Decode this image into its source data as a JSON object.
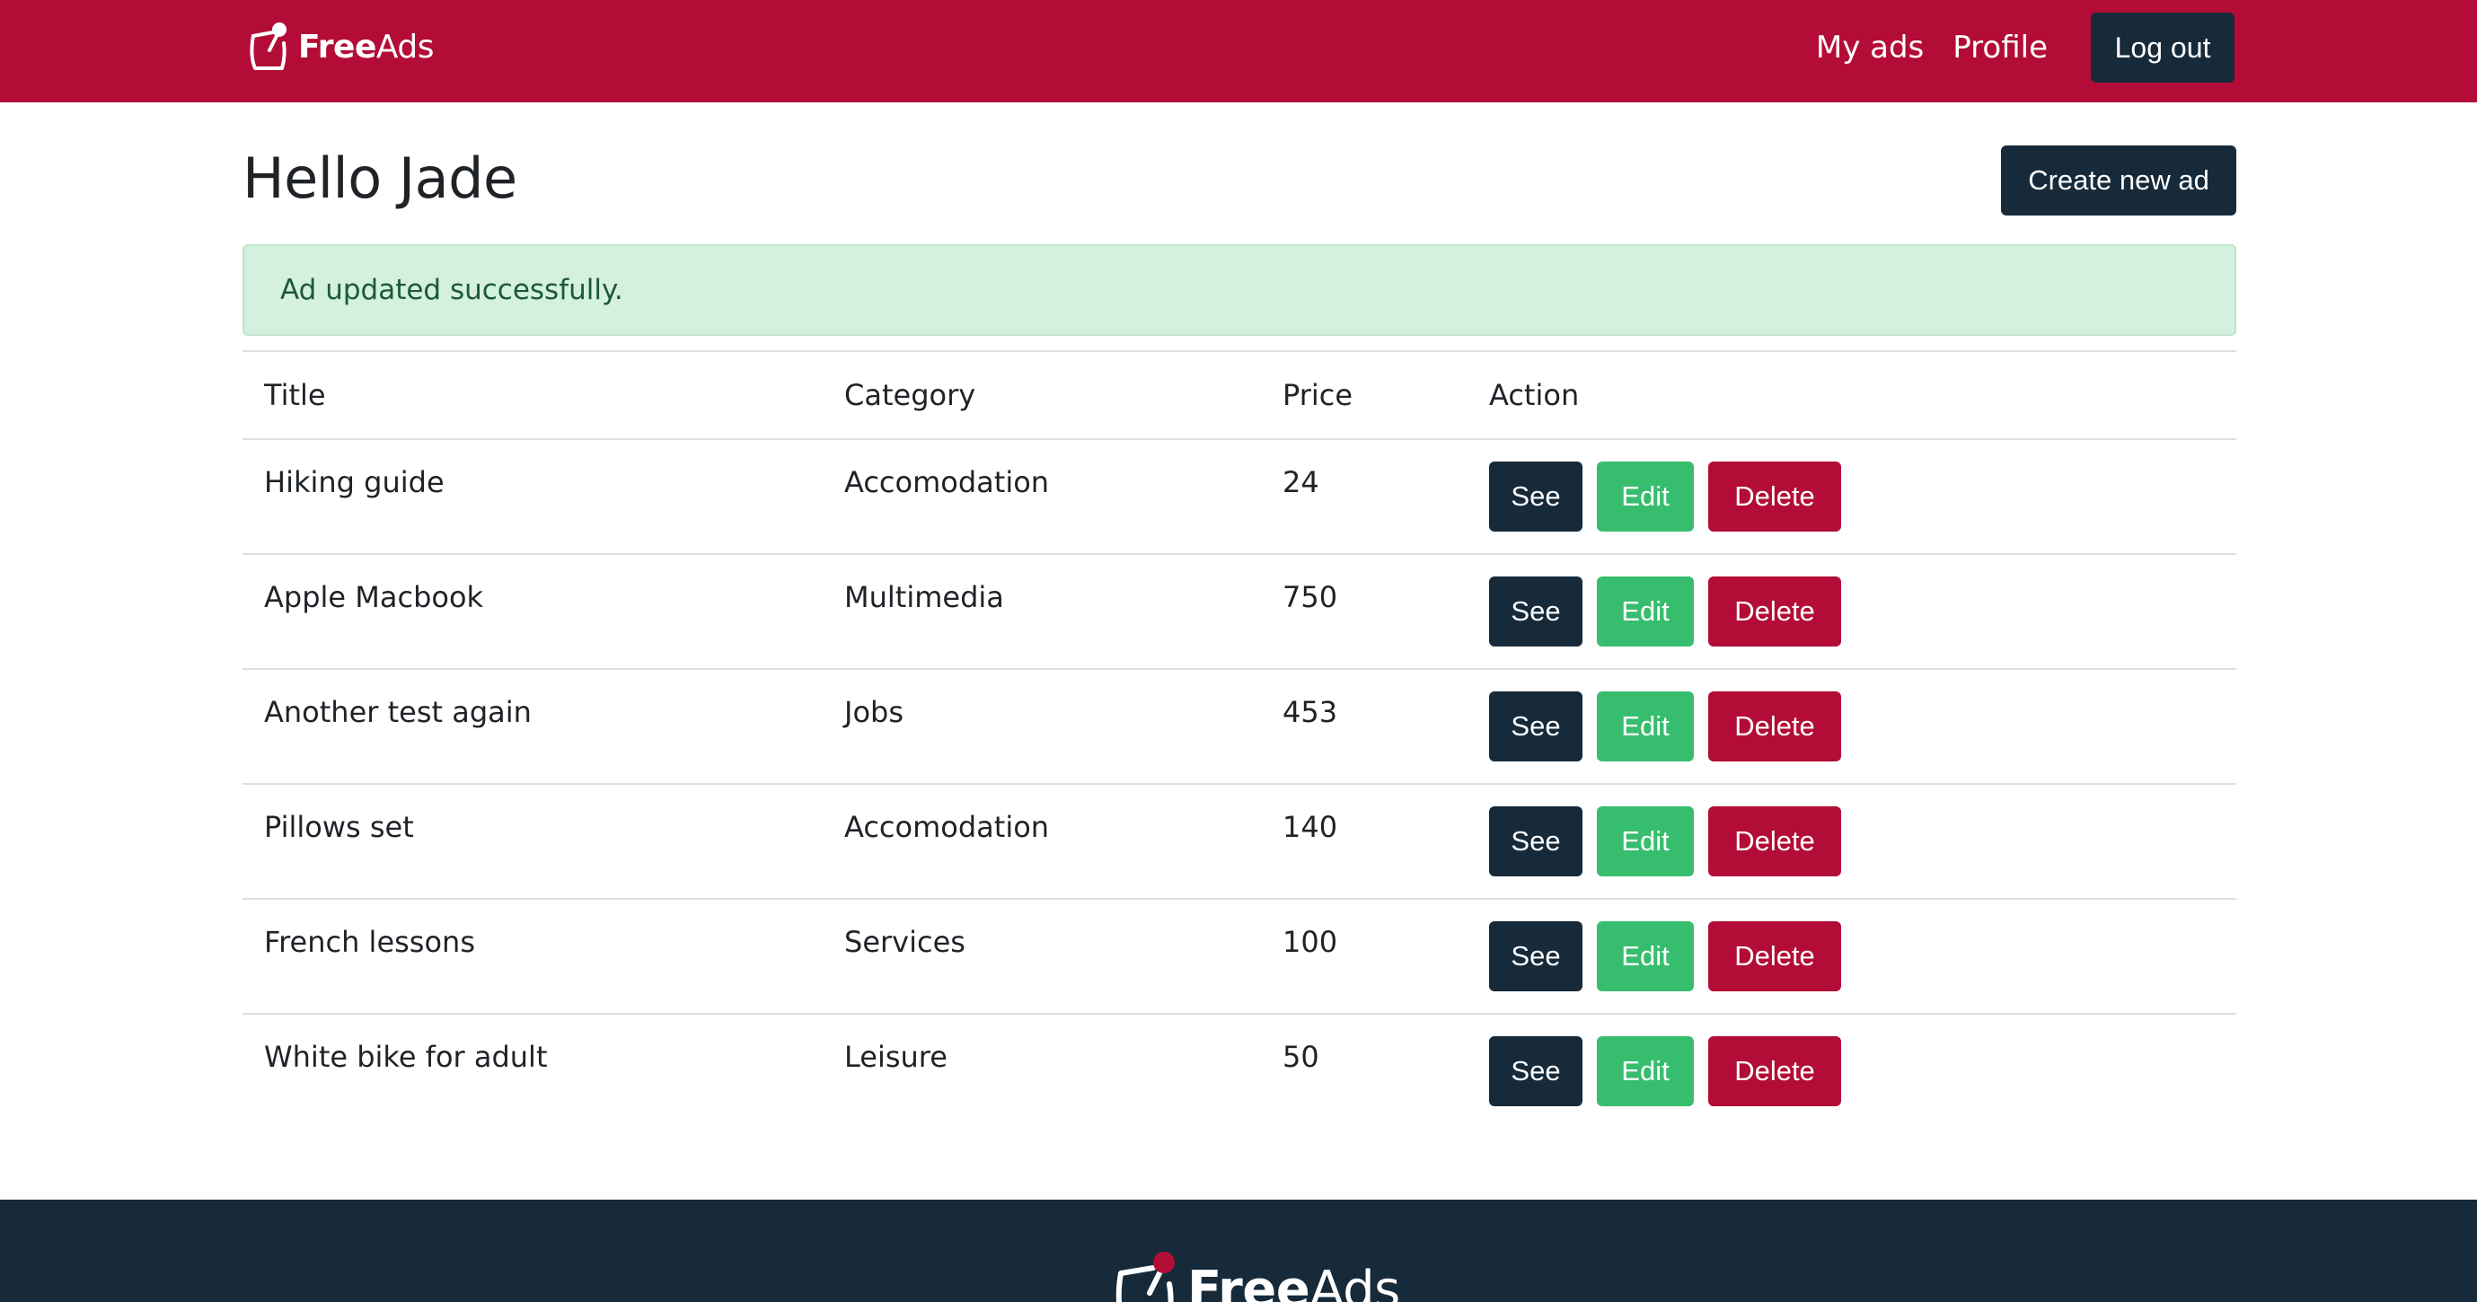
{
  "header": {
    "brand": {
      "part1": "Free",
      "part2": "Ads"
    },
    "nav": {
      "my_ads": "My ads",
      "profile": "Profile",
      "logout": "Log out"
    }
  },
  "main": {
    "greeting": "Hello Jade",
    "create_button": "Create new ad",
    "alert": "Ad updated successfully.",
    "table": {
      "headers": [
        "Title",
        "Category",
        "Price",
        "Action"
      ],
      "rows": [
        {
          "title": "Hiking guide",
          "category": "Accomodation",
          "price": "24"
        },
        {
          "title": "Apple Macbook",
          "category": "Multimedia",
          "price": "750"
        },
        {
          "title": "Another test again",
          "category": "Jobs",
          "price": "453"
        },
        {
          "title": "Pillows set",
          "category": "Accomodation",
          "price": "140"
        },
        {
          "title": "French lessons",
          "category": "Services",
          "price": "100"
        },
        {
          "title": "White bike for adult",
          "category": "Leisure",
          "price": "50"
        }
      ],
      "actions": {
        "see": "See",
        "edit": "Edit",
        "delete": "Delete"
      }
    }
  },
  "footer": {
    "brand": {
      "part1": "Free",
      "part2": "Ads"
    }
  },
  "colors": {
    "brand_red": "#b30d37",
    "dark_navy": "#162a3a",
    "success_green": "#37bd6e",
    "alert_bg": "#d4f0de",
    "alert_text": "#1c5a35"
  },
  "icons": {
    "logo": "pinned-note-icon"
  }
}
